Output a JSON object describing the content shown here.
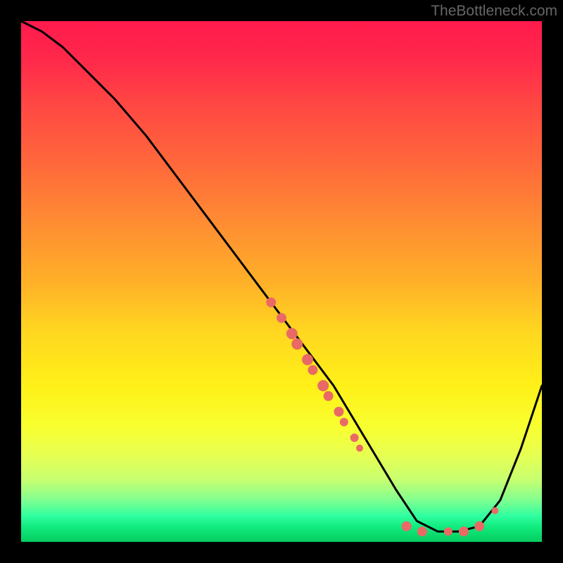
{
  "watermark": "TheBottleneck.com",
  "chart_data": {
    "type": "line",
    "title": "",
    "xlabel": "",
    "ylabel": "",
    "xlim": [
      0,
      100
    ],
    "ylim": [
      0,
      100
    ],
    "curve": {
      "x": [
        0,
        4,
        8,
        12,
        18,
        24,
        30,
        36,
        42,
        48,
        54,
        60,
        66,
        72,
        76,
        80,
        84,
        88,
        92,
        96,
        100
      ],
      "y": [
        100,
        98,
        95,
        91,
        85,
        78,
        70,
        62,
        54,
        46,
        38,
        30,
        20,
        10,
        4,
        2,
        2,
        3,
        8,
        18,
        30
      ]
    },
    "markers": [
      {
        "x": 48,
        "y": 46,
        "r": 7
      },
      {
        "x": 50,
        "y": 43,
        "r": 7
      },
      {
        "x": 52,
        "y": 40,
        "r": 8
      },
      {
        "x": 53,
        "y": 38,
        "r": 8
      },
      {
        "x": 55,
        "y": 35,
        "r": 8
      },
      {
        "x": 56,
        "y": 33,
        "r": 7
      },
      {
        "x": 58,
        "y": 30,
        "r": 8
      },
      {
        "x": 59,
        "y": 28,
        "r": 7
      },
      {
        "x": 61,
        "y": 25,
        "r": 7
      },
      {
        "x": 62,
        "y": 23,
        "r": 6
      },
      {
        "x": 64,
        "y": 20,
        "r": 6
      },
      {
        "x": 65,
        "y": 18,
        "r": 5
      },
      {
        "x": 74,
        "y": 3,
        "r": 7
      },
      {
        "x": 77,
        "y": 2,
        "r": 7
      },
      {
        "x": 82,
        "y": 2,
        "r": 6
      },
      {
        "x": 85,
        "y": 2,
        "r": 7
      },
      {
        "x": 88,
        "y": 3,
        "r": 7
      },
      {
        "x": 91,
        "y": 6,
        "r": 5
      }
    ],
    "marker_color": "#e96a65",
    "curve_color": "#000000",
    "curve_width": 3
  }
}
